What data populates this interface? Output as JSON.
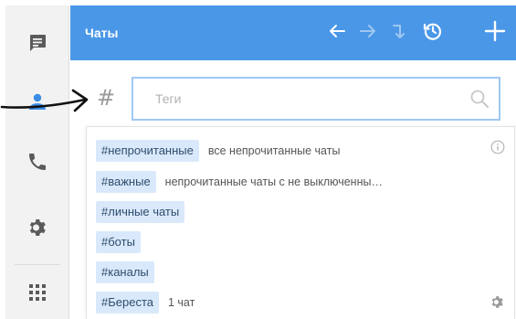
{
  "header": {
    "title": "Чаты",
    "background_color": "#4a97e8",
    "buttons": [
      {
        "icon": "arrow-left-icon",
        "enabled": true
      },
      {
        "icon": "arrow-right-icon",
        "enabled": false
      },
      {
        "icon": "turn-down-arrow-icon",
        "enabled": false
      },
      {
        "icon": "history-icon",
        "enabled": true
      },
      {
        "icon": "plus-icon",
        "enabled": true
      }
    ]
  },
  "sidebar": {
    "items": [
      {
        "icon": "chat-icon",
        "active": false
      },
      {
        "icon": "contacts-icon",
        "active": true
      },
      {
        "icon": "phone-icon",
        "active": false
      },
      {
        "icon": "gear-icon",
        "active": false
      },
      {
        "icon": "apps-grid-icon",
        "active": false
      }
    ],
    "active_color": "#3a8ee6",
    "icon_color": "#555555"
  },
  "search": {
    "prefix": "#",
    "placeholder": "Теги",
    "value": ""
  },
  "tags": [
    {
      "tag": "#непрочитанные",
      "description": "все непрочитанные чаты"
    },
    {
      "tag": "#важные",
      "description": "непрочитанные чаты с не выключенны…"
    },
    {
      "tag": "#личные чаты",
      "description": ""
    },
    {
      "tag": "#боты",
      "description": ""
    },
    {
      "tag": "#каналы",
      "description": ""
    },
    {
      "tag": "#Береста",
      "description": "1 чат"
    }
  ]
}
